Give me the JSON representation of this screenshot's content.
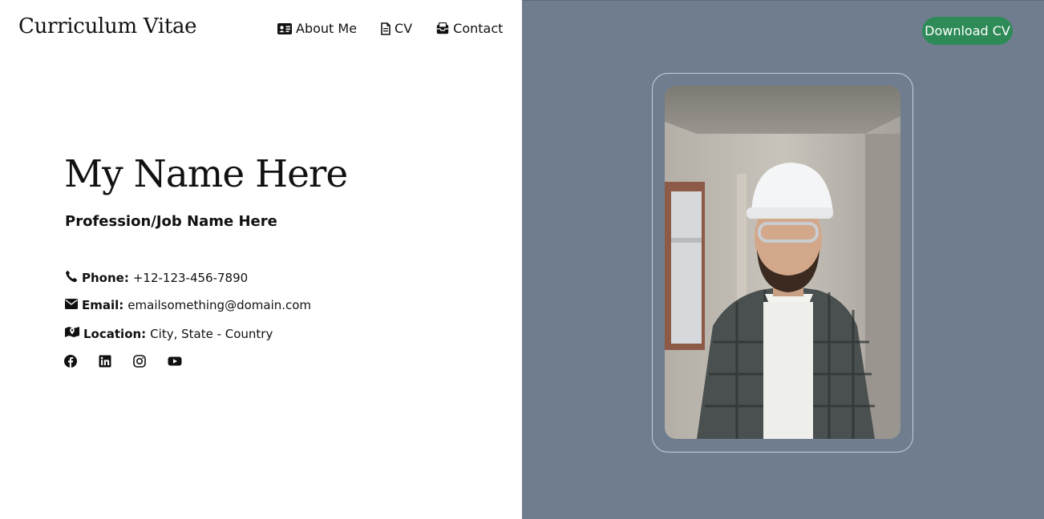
{
  "header": {
    "brand": "Curriculum Vitae",
    "nav": [
      {
        "label": "About Me",
        "icon": "id-card-icon"
      },
      {
        "label": "CV",
        "icon": "document-icon"
      },
      {
        "label": "Contact",
        "icon": "inbox-icon"
      }
    ],
    "download_label": "Download CV"
  },
  "hero": {
    "name": "My Name Here",
    "profession": "Profession/Job Name Here",
    "phone_label": "Phone:",
    "phone_value": "+12-123-456-7890",
    "email_label": "Email:",
    "email_value": "emailsomething@domain.com",
    "location_label": "Location:",
    "location_value": "City, State - Country",
    "socials": [
      "facebook-icon",
      "linkedin-icon",
      "instagram-icon",
      "youtube-icon"
    ]
  },
  "colors": {
    "right_panel": "#6f7d8f",
    "download_button": "#2e8b57"
  }
}
